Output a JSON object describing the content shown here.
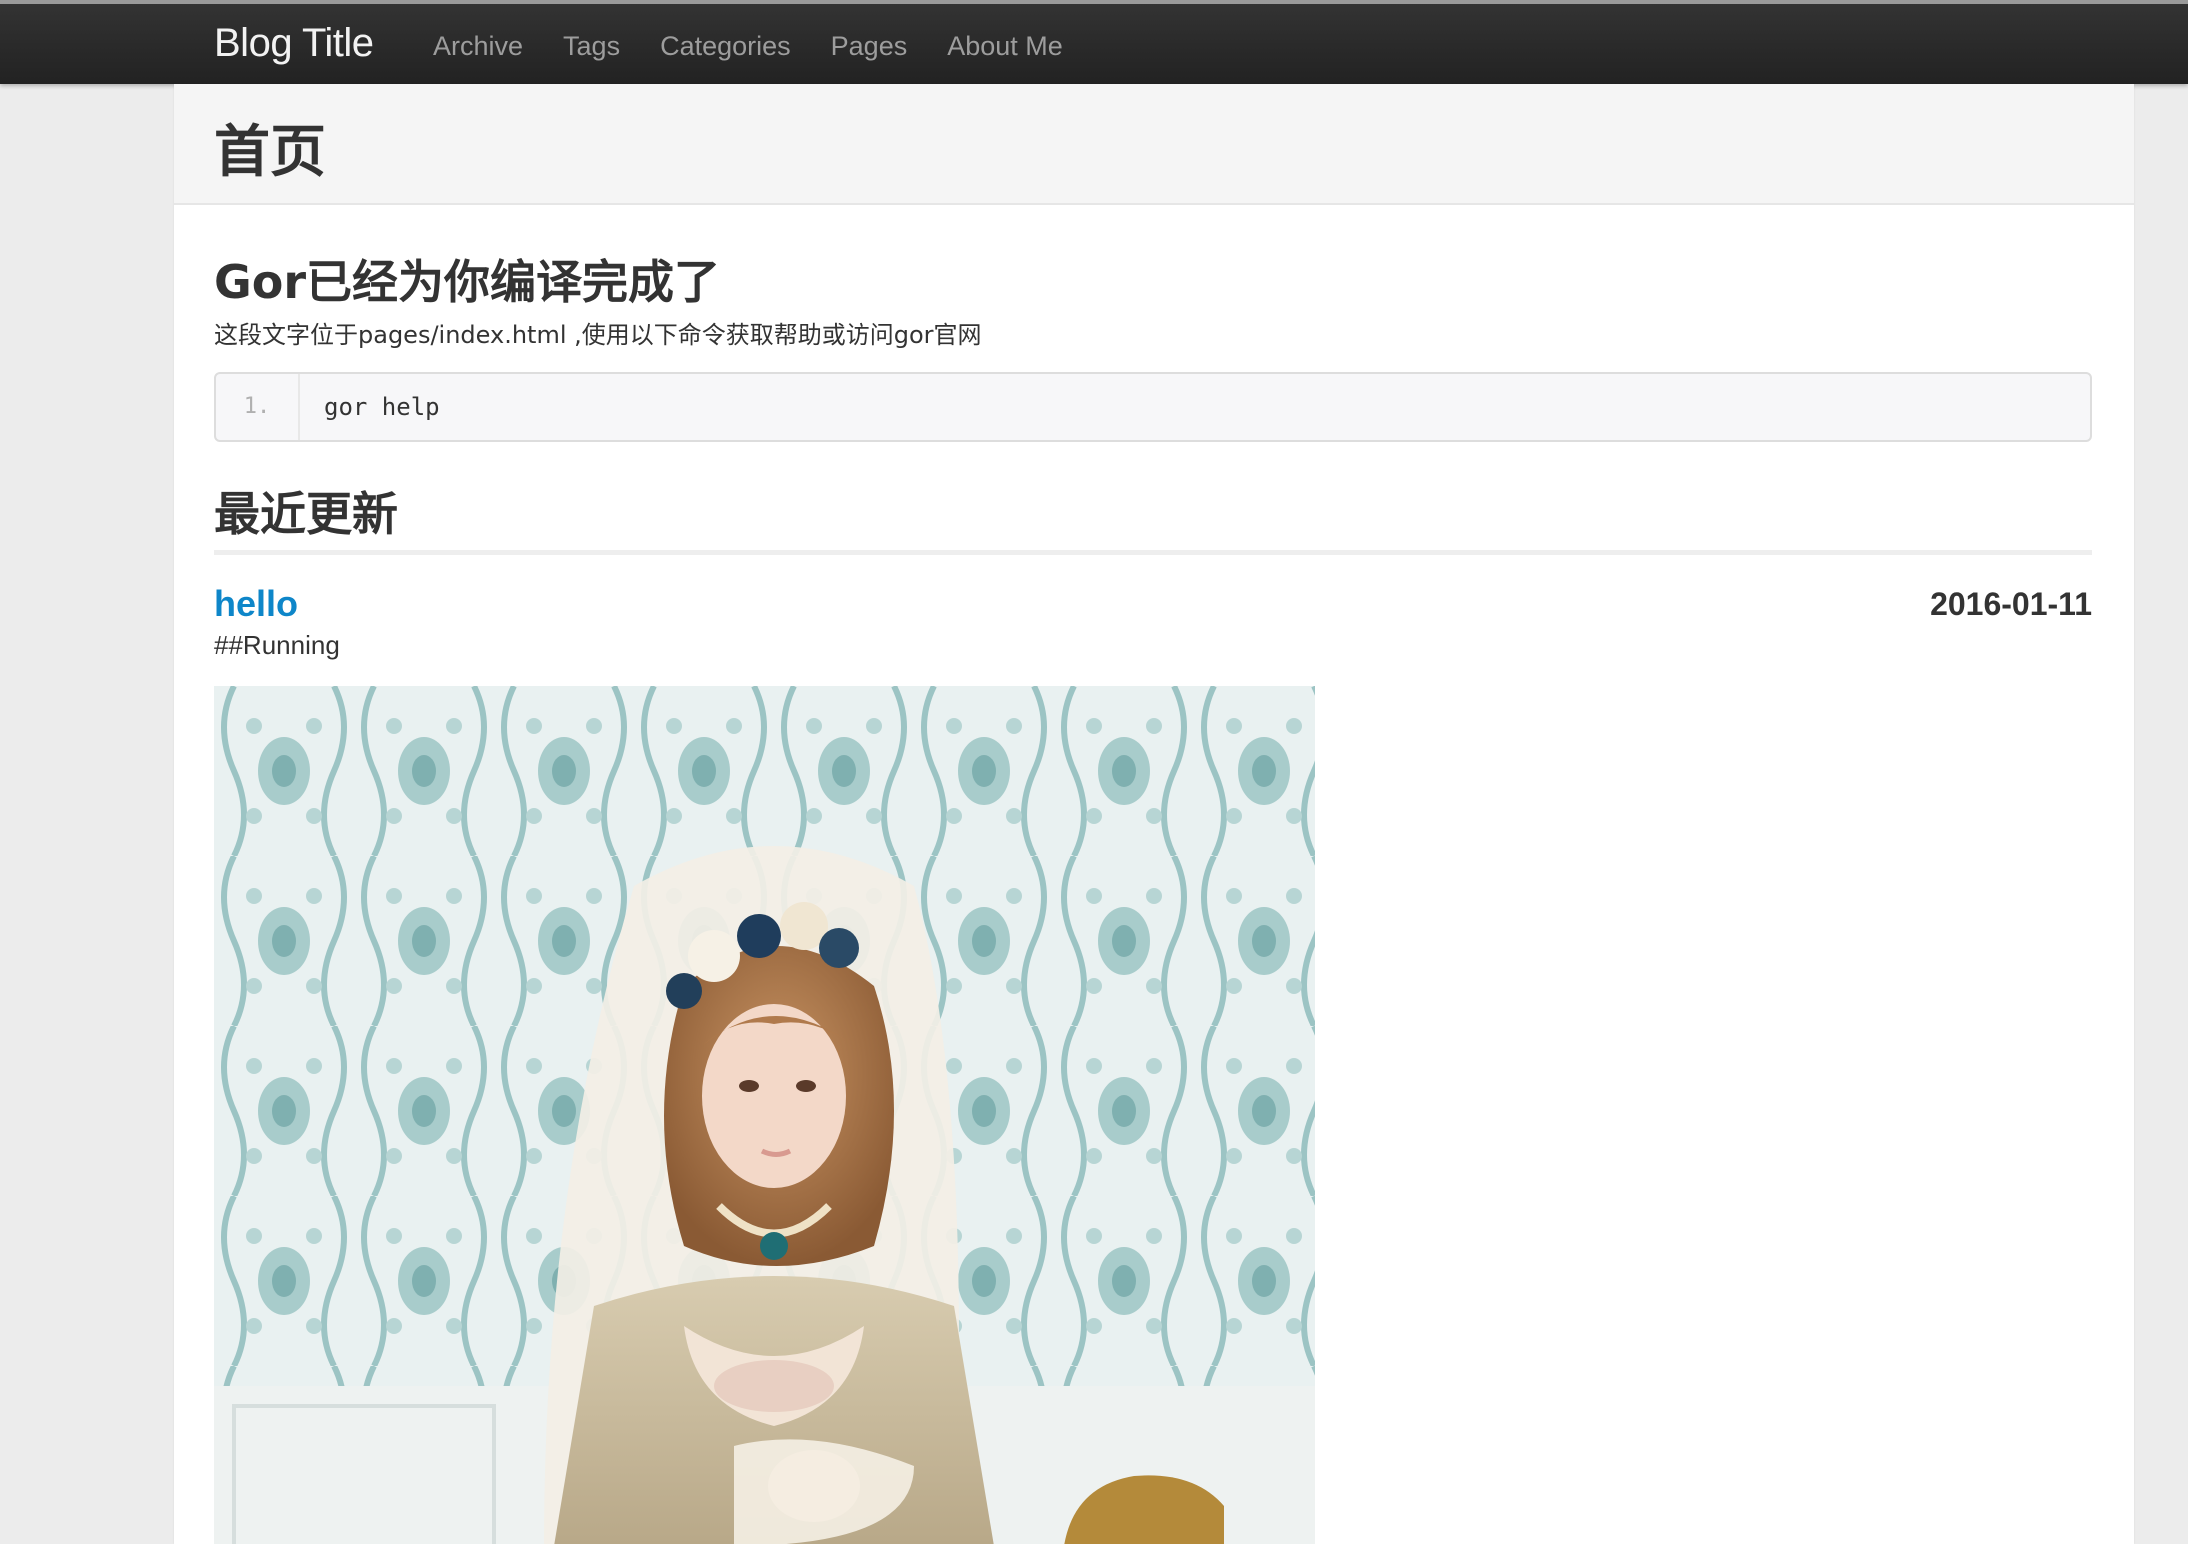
{
  "navbar": {
    "brand": "Blog Title",
    "links": [
      "Archive",
      "Tags",
      "Categories",
      "Pages",
      "About Me"
    ]
  },
  "page": {
    "title": "首页"
  },
  "hero": {
    "heading": "Gor已经为你编译完成了",
    "description": "这段文字位于pages/index.html ,使用以下命令获取帮助或访问gor官网",
    "code": {
      "line_number": "1.",
      "text": "gor help"
    }
  },
  "recent": {
    "heading": "最近更新",
    "posts": [
      {
        "title": "hello",
        "date": "2016-01-11",
        "summary": "##Running",
        "image_subject": "photo of a woman in a lace veil and vintage dress against floral wallpaper"
      }
    ]
  },
  "colors": {
    "navbar_bg": "#222222",
    "link_blue": "#0e86c9",
    "page_bg": "#ececec"
  }
}
